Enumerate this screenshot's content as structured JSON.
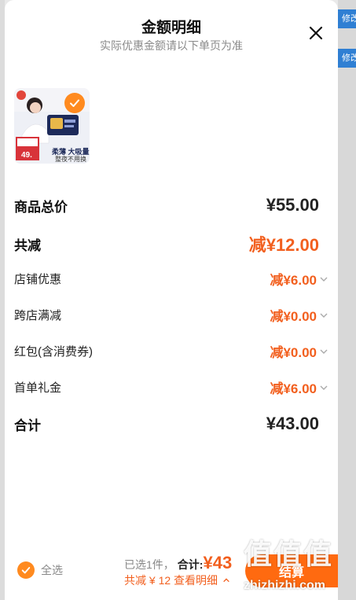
{
  "background": {
    "edit_buttons": [
      "修改",
      "修改"
    ]
  },
  "modal": {
    "title": "金额明细",
    "subtitle": "实际优惠金额请以下单页为准"
  },
  "product": {
    "image_text": [
      "柔薄 大吸量",
      "整夜不用换",
      "49."
    ]
  },
  "rows": [
    {
      "label": "商品总价",
      "value": "¥55.00"
    },
    {
      "label": "共减",
      "value": "减¥12.00"
    },
    {
      "label": "店铺优惠",
      "value": "减¥6.00"
    },
    {
      "label": "跨店满减",
      "value": "减¥0.00"
    },
    {
      "label": "红包(含消费券)",
      "value": "减¥0.00"
    },
    {
      "label": "首单礼金",
      "value": "减¥6.00"
    },
    {
      "label": "合计",
      "value": "¥43.00"
    }
  ],
  "bottom_bar": {
    "select_all": "全选",
    "selected_count": "已选1件，",
    "total_label": "合计:",
    "total_value": "¥43",
    "saving_text": "共减 ¥ 12  查看明细",
    "checkout": "结算"
  },
  "watermark": {
    "big": "值值值",
    "small": "zhizhizhi.com"
  },
  "colors": {
    "accent_orange": "#f25f1e",
    "button_orange": "#ff6a10",
    "check_orange": "#ff8a1f",
    "edit_blue": "#2f7fd3"
  },
  "icons": {
    "close": "close-icon",
    "chevron": "chevron-down-icon",
    "check": "check-icon"
  }
}
